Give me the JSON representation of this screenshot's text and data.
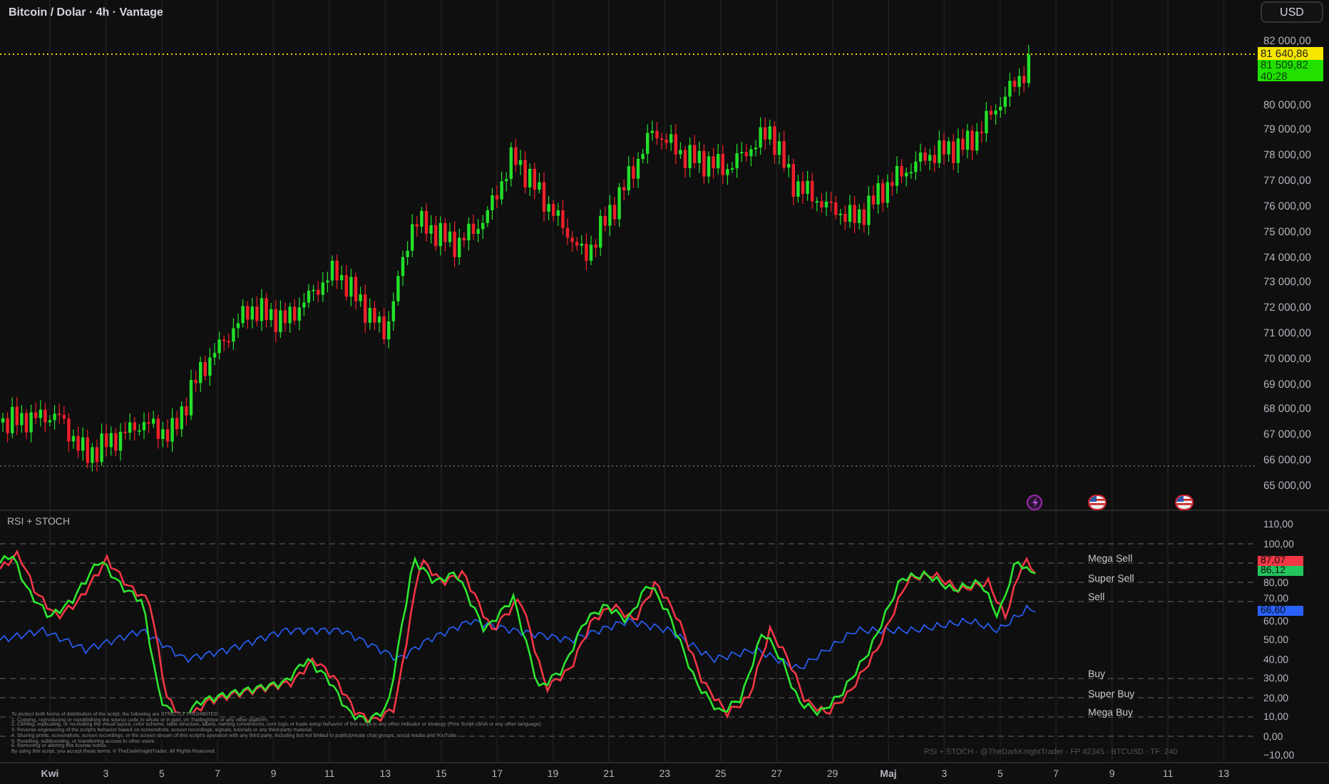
{
  "header": {
    "title": "Bitcoin / Dolar · 4h · Vantage",
    "currency_button": "USD"
  },
  "price_axis": {
    "labels": [
      "82 000,00",
      "80 000,00",
      "79 000,00",
      "78 000,00",
      "77 000,00",
      "76 000,00",
      "75 000,00",
      "74 000,00",
      "73 000,00",
      "72 000,00",
      "71 000,00",
      "70 000,00",
      "69 000,00",
      "68 000,00",
      "67 000,00",
      "66 000,00",
      "65 000,00"
    ],
    "last_price": "81 640,86",
    "current_price": "81 509,82",
    "countdown": "40:28"
  },
  "indicator": {
    "title": "RSI + STOCH",
    "level_labels": [
      "Mega Sell",
      "Super Sell",
      "Sell",
      "Buy",
      "Super Buy",
      "Mega Buy"
    ],
    "axis_labels": [
      "110,00",
      "100,00",
      "80,00",
      "70,00",
      "60,00",
      "50,00",
      "40,00",
      "30,00",
      "20,00",
      "10,00",
      "0,00",
      "−10,00"
    ],
    "value_badges": [
      {
        "text": "87,07",
        "color": "#f23645"
      },
      {
        "text": "86,12",
        "color": "#22c55e"
      },
      {
        "text": "66,60",
        "color": "#2962ff"
      }
    ],
    "disclaimer": [
      "To protect both forms of distribution of the script, the following are STRICTLY PROHIBITED:",
      "1. Copying, reproducing or republishing the source code in whole or in part, on TradingView or any other platform.",
      "2. Cloning, replicating, or recreating the visual layout, color scheme, table structure, labels, naming conventions, core logic or trade setup behavior of this script in any other indicator or strategy (Pine Script v5/v6 or any other language).",
      "3. Reverse engineering of the script's behavior based on screenshots, screen recordings, signals, tutorials or any third-party material.",
      "4. Sharing prints, screenshots, screen recordings, or the screen stream of this script's operation with any third party, including but not limited to public/private chat groups, social media and YouTube.",
      "5. Reselling, sublicensing, or transferring access to other users.",
      "6. Removing or altering this license notice.",
      "By using this script, you accept these terms. © TheDarkKnightTrader. All Rights Reserved."
    ],
    "footer_text": "RSI + STOCH - @TheDarkKnightTrader - FP 42345 - BTCUSD - TF: 240"
  },
  "x_axis": {
    "labels": [
      "Kwi",
      "3",
      "5",
      "7",
      "9",
      "11",
      "13",
      "15",
      "17",
      "19",
      "21",
      "23",
      "25",
      "27",
      "29",
      "Maj",
      "3",
      "5",
      "7",
      "9",
      "11",
      "13"
    ]
  }
}
